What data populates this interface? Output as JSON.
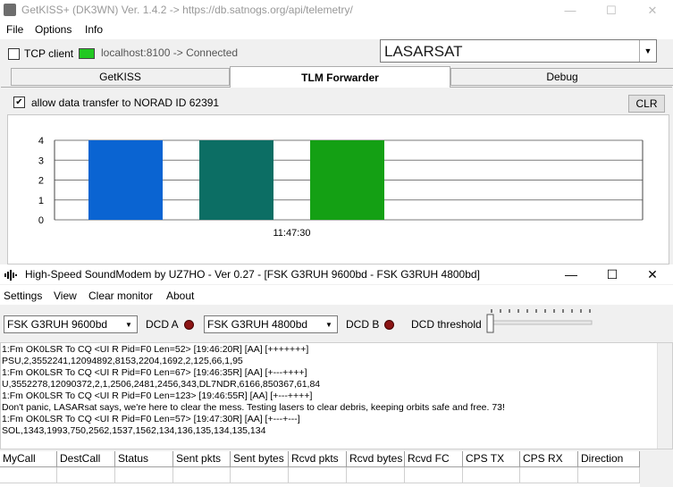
{
  "getkiss": {
    "title": "GetKISS+ (DK3WN) Ver. 1.4.2 -> https://db.satnogs.org/api/telemetry/",
    "menu": [
      "File",
      "Options",
      "Info"
    ],
    "tcp_client_label": "TCP client",
    "connection_status": "localhost:8100 -> Connected",
    "satellite": "LASARSAT",
    "tabs": [
      "GetKISS",
      "TLM Forwarder",
      "Debug"
    ],
    "active_tab": "TLM Forwarder",
    "allow_label": "allow data transfer to NORAD ID 62391",
    "clr_label": "CLR",
    "window_buttons": {
      "minimize": "—",
      "maximize": "☐",
      "close": "✕"
    }
  },
  "chart_data": {
    "type": "bar",
    "categories": [
      "",
      "",
      ""
    ],
    "values": [
      4,
      4,
      4
    ],
    "colors": [
      "#0a64d2",
      "#0c6e64",
      "#14a014"
    ],
    "ylim": [
      0,
      4
    ],
    "yticks": [
      "4",
      "3",
      "2",
      "1",
      "0"
    ],
    "xlabel_center": "11:47:30",
    "grid": true
  },
  "soundmodem": {
    "title": "High-Speed SoundModem by UZ7HO - Ver 0.27 - [FSK G3RUH 9600bd - FSK G3RUH 4800bd]",
    "menu": [
      "Settings",
      "View",
      "Clear monitor",
      "About"
    ],
    "modem_a": "FSK G3RUH 9600bd",
    "modem_b": "FSK G3RUH 4800bd",
    "dcd_a_label": "DCD A",
    "dcd_b_label": "DCD B",
    "dcd_threshold_label": "DCD threshold",
    "window_buttons": {
      "minimize": "—",
      "maximize": "☐",
      "close": "✕"
    },
    "monitor_lines": [
      "1:Fm OK0LSR To CQ <UI R Pid=F0 Len=52> [19:46:20R] [AA] [+++++++]",
      "PSU,2,3552241,12094892,8153,2204,1692,2,125,66,1,95",
      "1:Fm OK0LSR To CQ <UI R Pid=F0 Len=67> [19:46:35R] [AA] [+---++++]",
      "U,3552278,12090372,2,1,2506,2481,2456,343,DL7NDR,6166,850367,61,84",
      "1:Fm OK0LSR To CQ <UI R Pid=F0 Len=123> [19:46:55R] [AA] [+---++++]",
      "Don't panic, LASARsat says, we're here to clear the mess. Testing lasers to clear debris, keeping orbits safe and free. 73!",
      "1:Fm OK0LSR To CQ <UI R Pid=F0 Len=57> [19:47:30R] [AA] [+---+---]",
      "SOL,1343,1993,750,2562,1537,1562,134,136,135,134,135,134"
    ],
    "table_headers": [
      "MyCall",
      "DestCall",
      "Status",
      "Sent pkts",
      "Sent bytes",
      "Rcvd pkts",
      "Rcvd bytes",
      "Rcvd FC",
      "CPS TX",
      "CPS RX",
      "Direction"
    ]
  }
}
